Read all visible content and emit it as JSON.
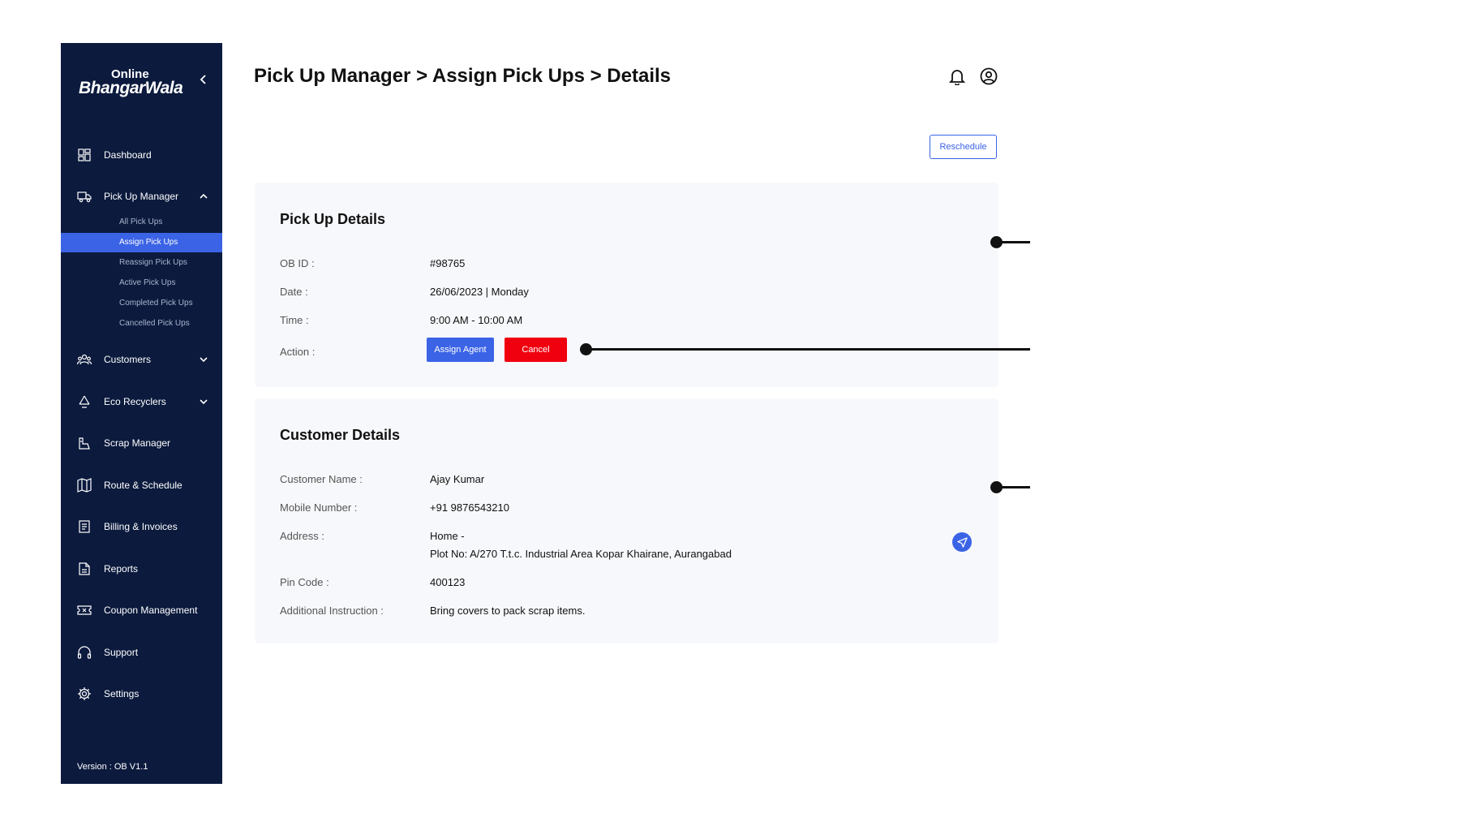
{
  "brand": {
    "line1": "Online",
    "line2": "BhangarWala"
  },
  "sidebar": {
    "items": [
      {
        "label": "Dashboard"
      },
      {
        "label": "Pick Up Manager"
      },
      {
        "label": "Customers"
      },
      {
        "label": "Eco Recyclers"
      },
      {
        "label": "Scrap Manager"
      },
      {
        "label": "Route & Schedule"
      },
      {
        "label": "Billing & Invoices"
      },
      {
        "label": "Reports"
      },
      {
        "label": "Coupon Management"
      },
      {
        "label": "Support"
      },
      {
        "label": "Settings"
      }
    ],
    "sub_items": [
      {
        "label": "All Pick Ups"
      },
      {
        "label": "Assign Pick Ups"
      },
      {
        "label": "Reassign Pick Ups"
      },
      {
        "label": "Active Pick Ups"
      },
      {
        "label": "Completed Pick Ups"
      },
      {
        "label": "Cancelled Pick Ups"
      }
    ],
    "version": "Version : OB V1.1"
  },
  "header": {
    "crumb1": "Pick Up Manager",
    "sep1": " > ",
    "crumb2": "Assign Pick Ups",
    "sep2": " > ",
    "crumb3": "Details"
  },
  "actions": {
    "reschedule": "Reschedule"
  },
  "pickup": {
    "title": "Pick Up Details",
    "rows": [
      {
        "label": "OB ID :",
        "value": "#98765"
      },
      {
        "label": "Date :",
        "value": "26/06/2023 | Monday"
      },
      {
        "label": "Time :",
        "value": "9:00 AM - 10:00 AM"
      }
    ],
    "action_label": "Action :",
    "assign_btn": "Assign Agent",
    "cancel_btn": "Cancel"
  },
  "customer": {
    "title": "Customer Details",
    "name_label": "Customer Name :",
    "name_value": "Ajay Kumar",
    "mobile_label": "Mobile Number :",
    "mobile_value": "+91 9876543210",
    "address_label": "Address :",
    "address_line1": "Home -",
    "address_line2": "Plot No: A/270 T.t.c. Industrial Area Kopar Khairane, Aurangabad",
    "pin_label": "Pin Code :",
    "pin_value": "400123",
    "instr_label": "Additional Instruction :",
    "instr_value": "Bring covers to pack scrap items."
  },
  "colors": {
    "sidebar_bg": "#0b1a3d",
    "accent": "#3b63e6",
    "danger": "#f0000f"
  },
  "icons": [
    "chevron-left-icon",
    "dashboard-icon",
    "truck-icon",
    "chevron-up-icon",
    "users-icon",
    "chevron-down-icon",
    "recycle-icon",
    "scrap-icon",
    "map-icon",
    "invoice-icon",
    "report-icon",
    "coupon-icon",
    "headset-icon",
    "gear-icon",
    "bell-icon",
    "user-circle-icon",
    "navigation-icon"
  ]
}
